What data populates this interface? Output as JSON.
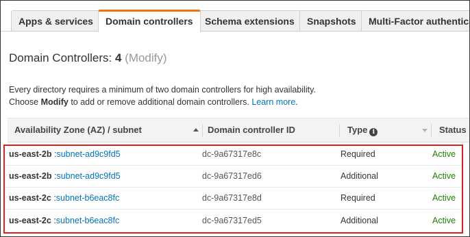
{
  "tabs": [
    {
      "label": "Apps & services",
      "active": false
    },
    {
      "label": "Domain controllers",
      "active": true
    },
    {
      "label": "Schema extensions",
      "active": false
    },
    {
      "label": "Snapshots",
      "active": false
    },
    {
      "label": "Multi-Factor authenticat",
      "active": false
    }
  ],
  "heading": {
    "prefix": "Domain Controllers: ",
    "count": "4",
    "open_paren": " (",
    "modify_link": "Modify",
    "close_paren": ")"
  },
  "description": {
    "line1": "Every directory requires a minimum of two domain controllers for high availability.",
    "line2_prefix": "Choose ",
    "line2_bold": "Modify",
    "line2_suffix": " to add or remove additional domain controllers. ",
    "learn_more": "Learn more",
    "line2_end": "."
  },
  "table": {
    "columns": {
      "az_subnet": "Availability Zone (AZ) / subnet",
      "dc_id": "Domain controller ID",
      "type": "Type",
      "status": "Status"
    },
    "sort": {
      "column": "az_subnet",
      "direction": "ascending"
    },
    "rows": [
      {
        "az": "us-east-2b",
        "sep": " :",
        "subnet": "subnet-ad9c9fd5",
        "dc_id": "dc-9a67317e8c",
        "type": "Required",
        "status": "Active"
      },
      {
        "az": "us-east-2b",
        "sep": " :",
        "subnet": "subnet-ad9c9fd5",
        "dc_id": "dc-9a67317ed6",
        "type": "Additional",
        "status": "Active"
      },
      {
        "az": "us-east-2c",
        "sep": " :",
        "subnet": "subnet-b6eac8fc",
        "dc_id": "dc-9a67317e8d",
        "type": "Required",
        "status": "Active"
      },
      {
        "az": "us-east-2c",
        "sep": " :",
        "subnet": "subnet-b6eac8fc",
        "dc_id": "dc-9a67317ed5",
        "type": "Additional",
        "status": "Active"
      }
    ]
  },
  "icons": {
    "info": "info-circle-icon",
    "sort_asc": "sort-ascending-icon",
    "sort_desc": "sort-descending-icon"
  },
  "colors": {
    "accent_tab": "#ec7211",
    "link": "#0073bb",
    "status_active": "#1d8102",
    "highlight": "#e01e1e"
  }
}
